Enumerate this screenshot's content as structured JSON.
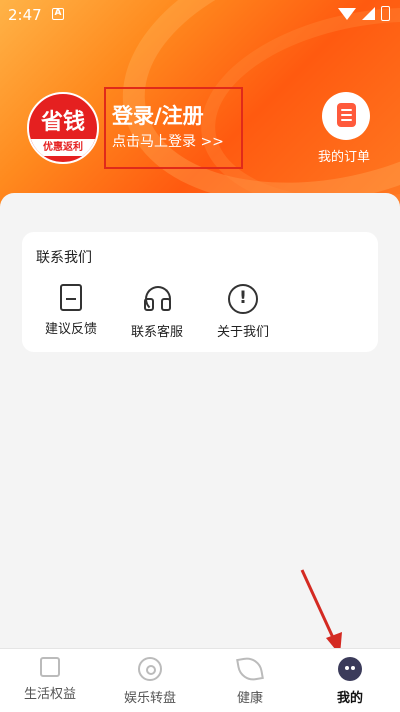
{
  "status_bar": {
    "time": "2:47",
    "notification_icon": "A"
  },
  "profile": {
    "avatar_top_text": "省钱",
    "avatar_strip_text": "优惠返利",
    "login_title": "登录/注册",
    "login_subtitle": "点击马上登录 >>"
  },
  "orders": {
    "label": "我的订单",
    "icon": "document-icon"
  },
  "contact_card": {
    "title": "联系我们",
    "items": [
      {
        "label": "建议反馈",
        "icon": "edit-icon"
      },
      {
        "label": "联系客服",
        "icon": "headset-icon"
      },
      {
        "label": "关于我们",
        "icon": "info-icon"
      }
    ]
  },
  "tabs": [
    {
      "label": "生活权益",
      "icon": "cup-icon",
      "active": false
    },
    {
      "label": "娱乐转盘",
      "icon": "disc-icon",
      "active": false
    },
    {
      "label": "健康",
      "icon": "leaf-icon",
      "active": false
    },
    {
      "label": "我的",
      "icon": "profile-icon",
      "active": true
    }
  ],
  "colors": {
    "accent": "#ff5a10",
    "highlight_box": "#e02a1a",
    "arrow": "#d42a22"
  }
}
